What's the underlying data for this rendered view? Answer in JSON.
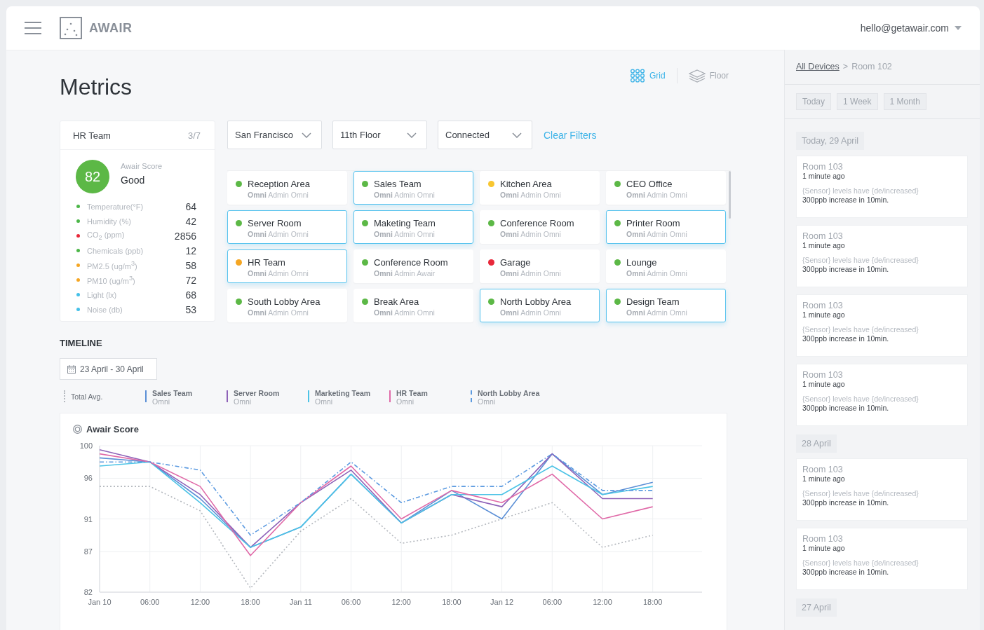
{
  "header": {
    "brand": "AWAIR",
    "user": "hello@getawair.com"
  },
  "page_title": "Metrics",
  "views": [
    {
      "label": "Grid",
      "kind": "grid",
      "selected": true
    },
    {
      "label": "Floor",
      "kind": "floor",
      "selected": false
    }
  ],
  "summary": {
    "title": "HR Team",
    "count": "3/7",
    "score": "82",
    "score_label": "Awair Score",
    "rating": "Good",
    "metrics": [
      {
        "label": "Temperature(°F)",
        "value": "64",
        "color": "#4cb648"
      },
      {
        "label": "Humidity (%)",
        "value": "42",
        "color": "#4cb648"
      },
      {
        "label": "CO$_{2}$ (ppm)",
        "value": "2856",
        "color": "#e8283a"
      },
      {
        "label": "Chemicals (ppb)",
        "value": "12",
        "color": "#4cb648"
      },
      {
        "label": "PM2.5 (ug/m$^{3}$)",
        "value": "58",
        "color": "#f5a623"
      },
      {
        "label": "PM10 (ug/m$^{3}$)",
        "value": "72",
        "color": "#f5a623"
      },
      {
        "label": "Light (lx)",
        "value": "68",
        "color": "#45c0e8"
      },
      {
        "label": "Noise (db)",
        "value": "53",
        "color": "#45c0e8"
      }
    ]
  },
  "filters": [
    {
      "value": "San Francisco"
    },
    {
      "value": "11th Floor"
    },
    {
      "value": "Connected"
    }
  ],
  "clear_filters": "Clear Filters",
  "devices": [
    {
      "name": "Reception Area",
      "model": "Omni",
      "owner": "Admin Omni",
      "color": "#5cb846",
      "selected": false
    },
    {
      "name": "Sales Team",
      "model": "Omni",
      "owner": "Admin Omni",
      "color": "#5cb846",
      "selected": true
    },
    {
      "name": "Kitchen Area",
      "model": "Omni",
      "owner": "Admin Omni",
      "color": "#f8c630",
      "selected": false
    },
    {
      "name": "CEO Office",
      "model": "Omni",
      "owner": "Admin Omni",
      "color": "#5cb846",
      "selected": false
    },
    {
      "name": "Server Room",
      "model": "Omni",
      "owner": "Admin Omni",
      "color": "#5cb846",
      "selected": true
    },
    {
      "name": "Maketing Team",
      "model": "Omni",
      "owner": "Admin Omni",
      "color": "#5cb846",
      "selected": true
    },
    {
      "name": "Conference Room",
      "model": "Omni",
      "owner": "Admin Omni",
      "color": "#5cb846",
      "selected": false
    },
    {
      "name": "Printer Room",
      "model": "Omni",
      "owner": "Admin Omni",
      "color": "#5cb846",
      "selected": true
    },
    {
      "name": "HR Team",
      "model": "Omni",
      "owner": "Admin Omni",
      "color": "#f5a623",
      "selected": true
    },
    {
      "name": "Conference Room",
      "model": "Omni",
      "owner": "Admin Awair",
      "color": "#5cb846",
      "selected": false
    },
    {
      "name": "Garage",
      "model": "Omni",
      "owner": "Admin Omni",
      "color": "#e8283a",
      "selected": false
    },
    {
      "name": "Lounge",
      "model": "Omni",
      "owner": "Admin Omni",
      "color": "#5cb846",
      "selected": false
    },
    {
      "name": "South Lobby Area",
      "model": "Omni",
      "owner": "Admin Omni",
      "color": "#5cb846",
      "selected": false
    },
    {
      "name": "Break Area",
      "model": "Omni",
      "owner": "Admin Omni",
      "color": "#5cb846",
      "selected": false
    },
    {
      "name": "North Lobby Area",
      "model": "Omni",
      "owner": "Admin Omni",
      "color": "#5cb846",
      "selected": true
    },
    {
      "name": "Design Team",
      "model": "Omni",
      "owner": "Admin Omni",
      "color": "#5cb846",
      "selected": true
    }
  ],
  "timeline": {
    "title": "TIMELINE",
    "date_range": "23 April - 30 April",
    "chart_title": "Awair Score",
    "legend_sublabels": [
      "Omni",
      "Omni",
      "Omni",
      "Omni",
      "Omni"
    ],
    "chart_data": {
      "type": "line",
      "grid": true,
      "categories": [
        "Jan 10",
        "06:00",
        "12:00",
        "18:00",
        "Jan 11",
        "06:00",
        "12:00",
        "18:00",
        "Jan 12",
        "06:00",
        "12:00",
        "18:00"
      ],
      "ylim": [
        82,
        100
      ],
      "yticks": [
        82,
        87,
        91,
        96,
        100
      ],
      "series": [
        {
          "name": "Total Avg.",
          "color": "#b4b8be",
          "line_style": "dotted",
          "values": [
            95,
            95,
            92,
            82.5,
            89.5,
            93.5,
            88,
            89,
            91,
            93,
            87.5,
            89
          ]
        },
        {
          "name": "Sales Team",
          "color": "#5b8fd6",
          "line_style": "solid",
          "values": [
            98.5,
            98,
            93.5,
            87.5,
            90,
            96.5,
            90.5,
            94.5,
            91,
            99,
            94,
            95.5
          ]
        },
        {
          "name": "Server Room",
          "color": "#8e62b8",
          "line_style": "solid",
          "values": [
            99.5,
            98,
            94,
            87.5,
            93,
            97,
            90.5,
            94,
            92.5,
            99,
            93.5,
            93.5
          ]
        },
        {
          "name": "Marketing Team",
          "color": "#4cc3e6",
          "line_style": "solid",
          "values": [
            97.5,
            98,
            93,
            87.5,
            90,
            96.5,
            90.5,
            94,
            94,
            97.5,
            94,
            95
          ]
        },
        {
          "name": "HR Team",
          "color": "#e06aa8",
          "line_style": "solid",
          "values": [
            99,
            98,
            95,
            86.5,
            93,
            97.5,
            91,
            94.5,
            93,
            96.5,
            91,
            92.5
          ]
        },
        {
          "name": "North Lobby Area",
          "color": "#5b9ae0",
          "line_style": "dashdot",
          "values": [
            98,
            98,
            97,
            89,
            93,
            98,
            93,
            95,
            95,
            99,
            94.5,
            94.5
          ]
        }
      ]
    }
  },
  "side": {
    "breadcrumb": {
      "link": "All Devices",
      "separator": ">",
      "current": "Room 102"
    },
    "ranges": [
      {
        "label": "Today"
      },
      {
        "label": "1 Week"
      },
      {
        "label": "1 Month"
      }
    ],
    "groups": [
      {
        "date": "Today, 29 April",
        "items": [
          {
            "title": "Room 103",
            "time": "1 minute ago",
            "message": "{Sensor} levels have {de/increased}",
            "detail": "300ppb increase in 10min."
          },
          {
            "title": "Room 103",
            "time": "1 minute ago",
            "message": "{Sensor} levels have {de/increased}",
            "detail": "300ppb increase in 10min."
          },
          {
            "title": "Room 103",
            "time": "1 minute ago",
            "message": "{Sensor} levels have {de/increased}",
            "detail": "300ppb increase in 10min."
          },
          {
            "title": "Room 103",
            "time": "1 minute ago",
            "message": "{Sensor} levels have {de/increased}",
            "detail": "300ppb increase in 10min."
          }
        ]
      },
      {
        "date": "28 April",
        "items": [
          {
            "title": "Room 103",
            "time": "1 minute ago",
            "message": "{Sensor} levels have {de/increased}",
            "detail": "300ppb increase in 10min."
          },
          {
            "title": "Room 103",
            "time": "1 minute ago",
            "message": "{Sensor} levels have {de/increased}",
            "detail": "300ppb increase in 10min."
          }
        ]
      },
      {
        "date": "27 April"
      }
    ]
  }
}
